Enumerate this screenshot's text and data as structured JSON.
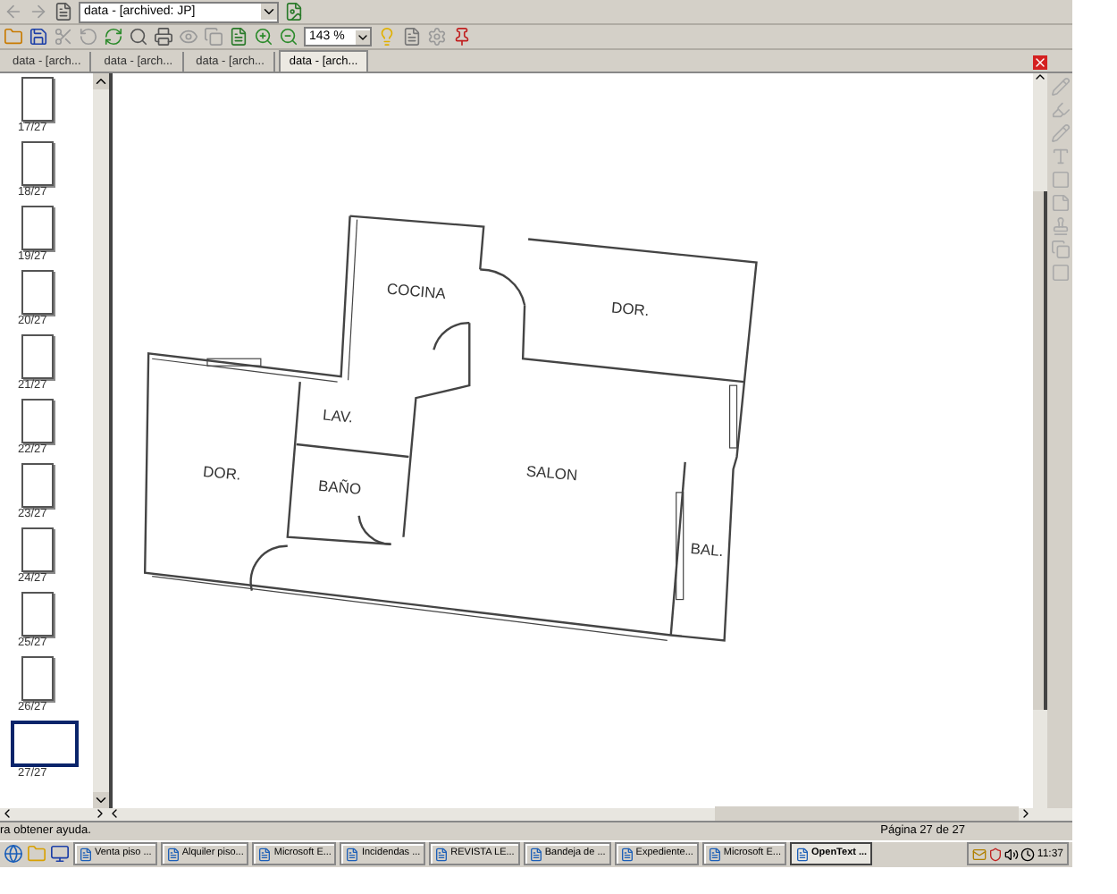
{
  "document_selector": {
    "value": "data - [archived: JP]"
  },
  "zoom": {
    "value": "143 %"
  },
  "tabs": [
    {
      "label": "data - [arch...",
      "selected": false
    },
    {
      "label": "data - [arch...",
      "selected": false
    },
    {
      "label": "data - [arch...",
      "selected": false
    },
    {
      "label": "data - [arch...",
      "selected": true
    }
  ],
  "thumbnails": [
    {
      "label": "17/27",
      "selected": false
    },
    {
      "label": "18/27",
      "selected": false
    },
    {
      "label": "19/27",
      "selected": false
    },
    {
      "label": "20/27",
      "selected": false
    },
    {
      "label": "21/27",
      "selected": false
    },
    {
      "label": "22/27",
      "selected": false
    },
    {
      "label": "23/27",
      "selected": false
    },
    {
      "label": "24/27",
      "selected": false
    },
    {
      "label": "25/27",
      "selected": false
    },
    {
      "label": "26/27",
      "selected": false
    },
    {
      "label": "27/27",
      "selected": true
    }
  ],
  "floor_plan": {
    "rooms": [
      "COCINA",
      "DOR.",
      "LAV.",
      "DOR.",
      "BAÑO",
      "SALON",
      "BAL."
    ]
  },
  "status_bar": {
    "help": "ra obtener ayuda.",
    "page": "Página 27 de 27"
  },
  "taskbar": {
    "items": [
      {
        "label": "Venta piso ...",
        "selected": false
      },
      {
        "label": "Alquiler piso...",
        "selected": false
      },
      {
        "label": "Microsoft E...",
        "selected": false
      },
      {
        "label": "Incidendas ...",
        "selected": false
      },
      {
        "label": "REVISTA LE...",
        "selected": false
      },
      {
        "label": "Bandeja de ...",
        "selected": false
      },
      {
        "label": "Expediente...",
        "selected": false
      },
      {
        "label": "Microsoft E...",
        "selected": false
      },
      {
        "label": "OpenText ...",
        "selected": true
      }
    ],
    "clock": "11:37"
  }
}
